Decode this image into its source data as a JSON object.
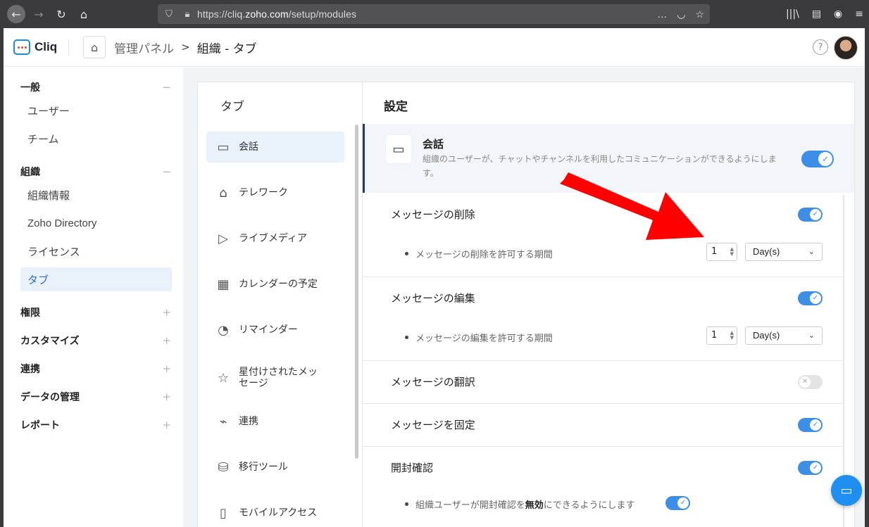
{
  "browser": {
    "url_prefix": "https://cliq.",
    "url_domain": "zoho.com",
    "url_path": "/setup/modules",
    "more_icon": "…",
    "library_icon": "library-icon"
  },
  "header": {
    "logo_text": "Cliq",
    "breadcrumb_parent": "管理パネル",
    "breadcrumb_sep": ">",
    "breadcrumb_current": "組織 - タブ",
    "help_icon": "?"
  },
  "sidebar": {
    "sections": [
      {
        "label": "一般",
        "toggle": "−"
      },
      {
        "label": "組織",
        "toggle": "−"
      },
      {
        "label": "権限",
        "toggle": "+"
      },
      {
        "label": "カスタマイズ",
        "toggle": "+"
      },
      {
        "label": "連携",
        "toggle": "+"
      },
      {
        "label": "データの管理",
        "toggle": "+"
      },
      {
        "label": "レポート",
        "toggle": "+"
      }
    ],
    "general_items": [
      "ユーザー",
      "チーム"
    ],
    "org_items": [
      "組織情報",
      "Zoho Directory",
      "ライセンス",
      "タブ"
    ]
  },
  "tabs": {
    "title": "タブ",
    "items": [
      {
        "label": "会話",
        "icon": "chat-icon"
      },
      {
        "label": "テレワーク",
        "icon": "home-icon"
      },
      {
        "label": "ライブメディア",
        "icon": "video-icon"
      },
      {
        "label": "カレンダーの予定",
        "icon": "calendar-icon"
      },
      {
        "label": "リマインダー",
        "icon": "reminder-icon"
      },
      {
        "label": "星付けされたメッセージ",
        "icon": "star-icon"
      },
      {
        "label": "連携",
        "icon": "plug-icon"
      },
      {
        "label": "移行ツール",
        "icon": "database-icon"
      },
      {
        "label": "モバイルアクセス",
        "icon": "mobile-icon"
      }
    ]
  },
  "settings": {
    "title": "設定",
    "feature": {
      "title": "会話",
      "desc": "組織のユーザーが、チャットやチャンネルを利用したコミュニケーションができるようにします。",
      "enabled": true
    },
    "delete": {
      "label": "メッセージの削除",
      "enabled": true,
      "sub_label": "メッセージの削除を許可する期間",
      "value": "1",
      "unit": "Day(s)"
    },
    "edit": {
      "label": "メッセージの編集",
      "enabled": true,
      "sub_label": "メッセージの編集を許可する期間",
      "value": "1",
      "unit": "Day(s)"
    },
    "translate": {
      "label": "メッセージの翻訳",
      "enabled": false
    },
    "pin": {
      "label": "メッセージを固定",
      "enabled": true
    },
    "read_receipt": {
      "label": "開封確認",
      "enabled": true,
      "sub_label_a": "組織ユーザーが開封確認を",
      "sub_label_bold": "無効",
      "sub_label_b": "にできるようにします",
      "sub_enabled": true
    }
  },
  "colors": {
    "accent": "#3d8ee6",
    "arrow": "#ff0000",
    "active_bg": "#e9f1fb"
  }
}
